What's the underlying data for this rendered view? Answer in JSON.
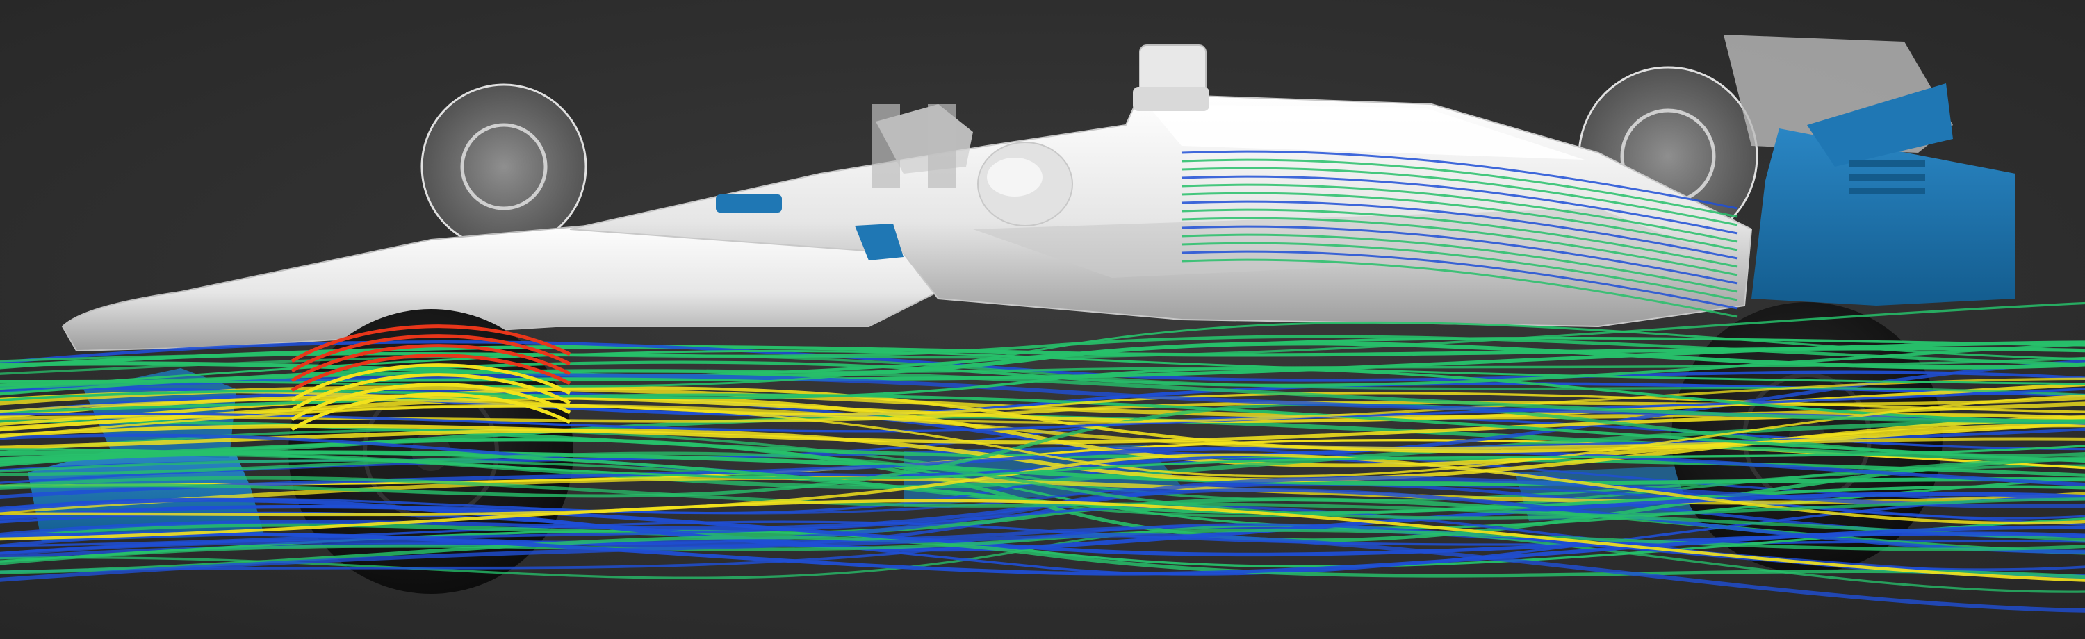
{
  "scene": {
    "subject": "formula-one-car-cfd-streamlines",
    "colors": {
      "background": "#2b2b2b",
      "body_light": "#f2f2f2",
      "body_shadow": "#9a9a9a",
      "wireframe": "#d8d8d8",
      "aero_parts": "#1e6fa8",
      "tyre": "#151515",
      "streamline_low": "#1f4fd6",
      "streamline_mid": "#27c06a",
      "streamline_high": "#f2e21c",
      "streamline_peak": "#e8361a"
    }
  }
}
